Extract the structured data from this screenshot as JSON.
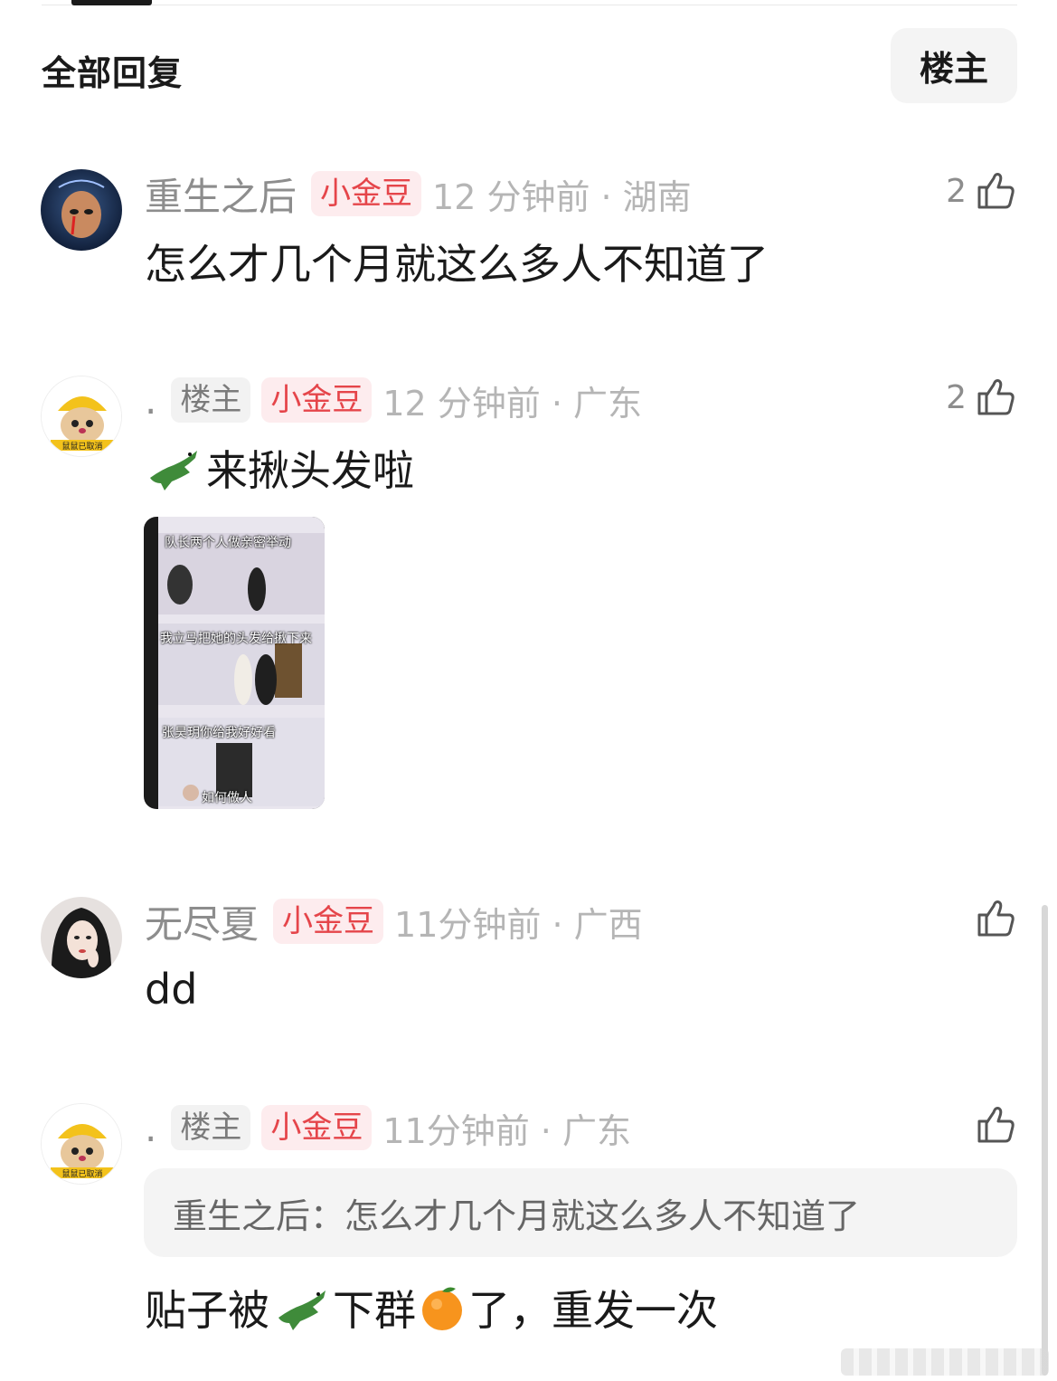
{
  "header": {
    "section_title": "全部回复",
    "filter_button": "楼主"
  },
  "comments": [
    {
      "username": "重生之后",
      "badge_gold": "小金豆",
      "time_location": "12 分钟前 · 湖南",
      "likes": "2",
      "text": "怎么才几个月就这么多人不知道了"
    },
    {
      "username": ".",
      "badge_op": "楼主",
      "badge_gold": "小金豆",
      "time_location": "12 分钟前 · 广东",
      "likes": "2",
      "text": "来揪头发啦",
      "image_captions": {
        "top_small": "队长两个人做亲密举动",
        "caption1": "队长两个人做亲密举动",
        "small2": "我立马把她的头发给揪下来",
        "caption2": "我立马把她的头发给揪下来",
        "caption3": "张昊玥你给我好好看",
        "caption4": "如何做人"
      }
    },
    {
      "username": "无尽夏",
      "badge_gold": "小金豆",
      "time_location": "11分钟前 · 广西",
      "text": "dd"
    },
    {
      "username": ".",
      "badge_op": "楼主",
      "badge_gold": "小金豆",
      "time_location": "11分钟前 · 广东",
      "quote": "重生之后：怎么才几个月就这么多人不知道了",
      "text_part1": "贴子被",
      "text_part2": "下群",
      "text_part3": "了，重发一次"
    }
  ],
  "icons": {
    "like": "thumbs-up-icon",
    "croc": "crocodile-emoji",
    "orange": "tangerine-emoji"
  },
  "colors": {
    "badge_gold_text": "#e5454a",
    "badge_gold_bg": "#fdecee",
    "muted_text": "#8d8d8d",
    "time_text": "#b5b5b5"
  }
}
